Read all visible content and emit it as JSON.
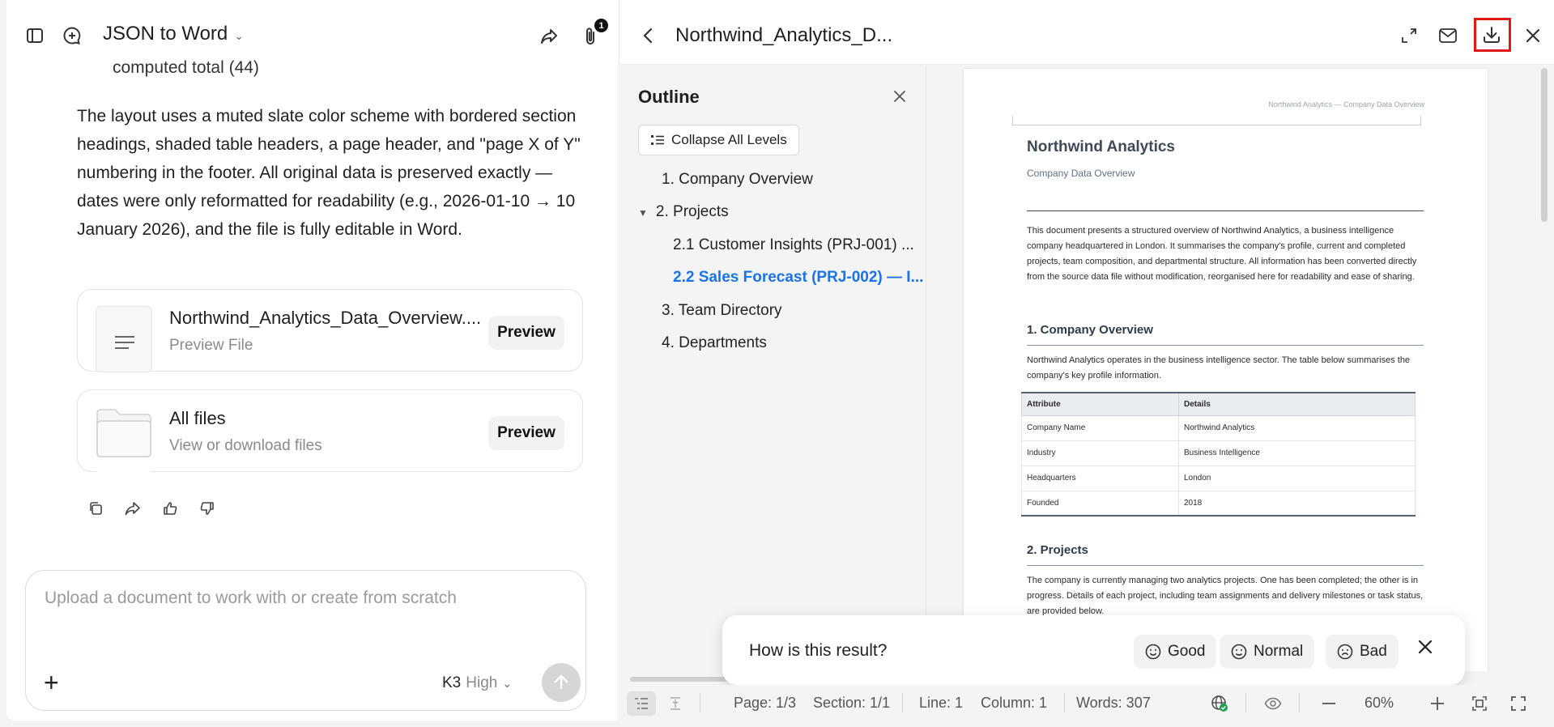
{
  "chat": {
    "title": "JSON to Word",
    "attachments_count": "1",
    "computed_line": "computed total (44)",
    "message": "The layout uses a muted slate color scheme with bordered section headings, shaded table headers, a page header, and \"page X of Y\" numbering in the footer. All original data is preserved exactly — dates were only reformatted for readability (e.g., 2026-01-10 → 10 January 2026), and the file is fully editable in Word.",
    "file_card": {
      "name": "Northwind_Analytics_Data_Overview....",
      "subtitle": "Preview File",
      "button": "Preview"
    },
    "all_files_card": {
      "name": "All files",
      "subtitle": "View or download files",
      "button": "Preview"
    },
    "composer": {
      "placeholder": "Upload a document to work with or create from scratch",
      "model": "K3",
      "level": "High"
    }
  },
  "preview": {
    "title": "Northwind_Analytics_D...",
    "outline": {
      "title": "Outline",
      "collapse_label": "Collapse All Levels",
      "items": [
        "1. Company Overview",
        "2. Projects",
        "2.1 Customer Insights (PRJ-001) ...",
        "2.2 Sales Forecast (PRJ-002) — I...",
        "3. Team Directory",
        "4. Departments"
      ]
    },
    "document": {
      "page_header": "Northwind Analytics — Company Data Overview",
      "title": "Northwind Analytics",
      "subtitle": "Company Data Overview",
      "intro": "This document presents a structured overview of Northwind Analytics, a business intelligence company headquartered in London. It summarises the company's profile, current and completed projects, team composition, and departmental structure. All information has been converted directly from the source data file without modification, reorganised here for readability and ease of sharing.",
      "section1_heading": "1. Company Overview",
      "section1_text": "Northwind Analytics operates in the business intelligence sector. The table below summarises the company's key profile information.",
      "table": {
        "headers": [
          "Attribute",
          "Details"
        ],
        "rows": [
          [
            "Company Name",
            "Northwind Analytics"
          ],
          [
            "Industry",
            "Business Intelligence"
          ],
          [
            "Headquarters",
            "London"
          ],
          [
            "Founded",
            "2018"
          ]
        ]
      },
      "section2_heading": "2. Projects",
      "section2_text": "The company is currently managing two analytics projects. One has been completed; the other is in progress. Details of each project, including team assignments and delivery milestones or task status, are provided below."
    },
    "feedback": {
      "question": "How is this result?",
      "good": "Good",
      "normal": "Normal",
      "bad": "Bad"
    },
    "status": {
      "page": "Page: 1/3",
      "section": "Section: 1/1",
      "line": "Line: 1",
      "column": "Column: 1",
      "words": "Words: 307",
      "zoom": "60%"
    }
  },
  "colors": {
    "accent_blue": "#1a73e8",
    "highlight_red": "#e01818",
    "slate": "#3f4a57"
  }
}
